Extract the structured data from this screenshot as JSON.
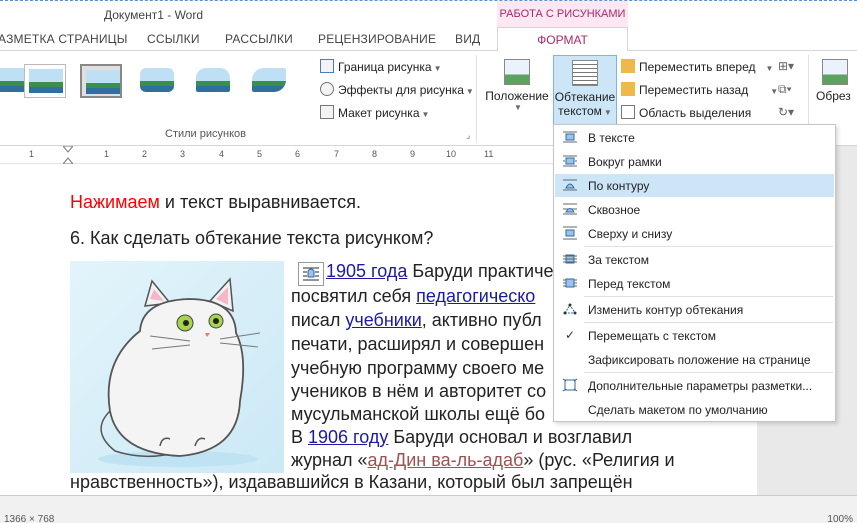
{
  "window": {
    "title": "Документ1 - Word"
  },
  "context_group": {
    "label": "РАБОТА С РИСУНКАМИ"
  },
  "ribbon_tabs": {
    "page_layout": "АЗМЕТКА СТРАНИЦЫ",
    "references": "ССЫЛКИ",
    "mailings": "РАССЫЛКИ",
    "review": "РЕЦЕНЗИРОВАНИЕ",
    "view": "ВИД",
    "format": "ФОРМАТ"
  },
  "ribbon": {
    "picture_border": "Граница рисунка",
    "picture_effects": "Эффекты для рисунка",
    "picture_layout": "Макет рисунка",
    "styles_group": "Стили рисунков",
    "position": "Положение",
    "wrap_text_line1": "Обтекание",
    "wrap_text_line2": "текстом",
    "bring_forward": "Переместить вперед",
    "send_backward": "Переместить назад",
    "selection_pane": "Область выделения",
    "crop": "Обрез"
  },
  "ruler": {
    "numbers": [
      "1",
      "1",
      "2",
      "3",
      "4",
      "5",
      "6",
      "7",
      "8",
      "9",
      "10",
      "11"
    ]
  },
  "document": {
    "line1_red": "Нажимаем",
    "line1_rest": " и текст выравнивается.",
    "heading": "6. Как сделать обтекание текста рисунком?",
    "p1_pre": "С ",
    "p1_link": "1905 года",
    "p1_post": " Баруди практичес",
    "p2_pre": "посвятил себя ",
    "p2_link": "педагогическо",
    "p3_pre": "писал ",
    "p3_link": "учебники",
    "p3_post": ", активно публ",
    "p4": "печати, расширял и совершен",
    "p5": "учебную программу своего ме",
    "p6": "учеников в нём и авторитет со",
    "p7": "мусульманской школы ещё бо",
    "p8_pre": "В ",
    "p8_link": "1906 году",
    "p8_post": " Баруди основал и возглавил",
    "p9_pre": "журнал «",
    "p9_link": "ад-Дин ва-ль-адаб",
    "p9_post": "» (рус. «Религия и",
    "p10": "нравственность»), издававшийся в Казани, который был запрещён"
  },
  "wrap_menu": {
    "items": [
      "В тексте",
      "Вокруг рамки",
      "По контуру",
      "Сквозное",
      "Сверху и снизу",
      "За текстом",
      "Перед текстом",
      "Изменить контур обтекания",
      "Перемещать с текстом",
      "Зафиксировать положение на странице",
      "Дополнительные параметры разметки...",
      "Сделать макетом по умолчанию"
    ]
  },
  "statusbar": {
    "left": "1366 × 768",
    "zoom": "100%"
  },
  "colors": {
    "context_accent": "#a62a6a",
    "menu_highlight": "#cde6f7",
    "link": "#1a1aa6",
    "red_text": "#ff0000"
  }
}
